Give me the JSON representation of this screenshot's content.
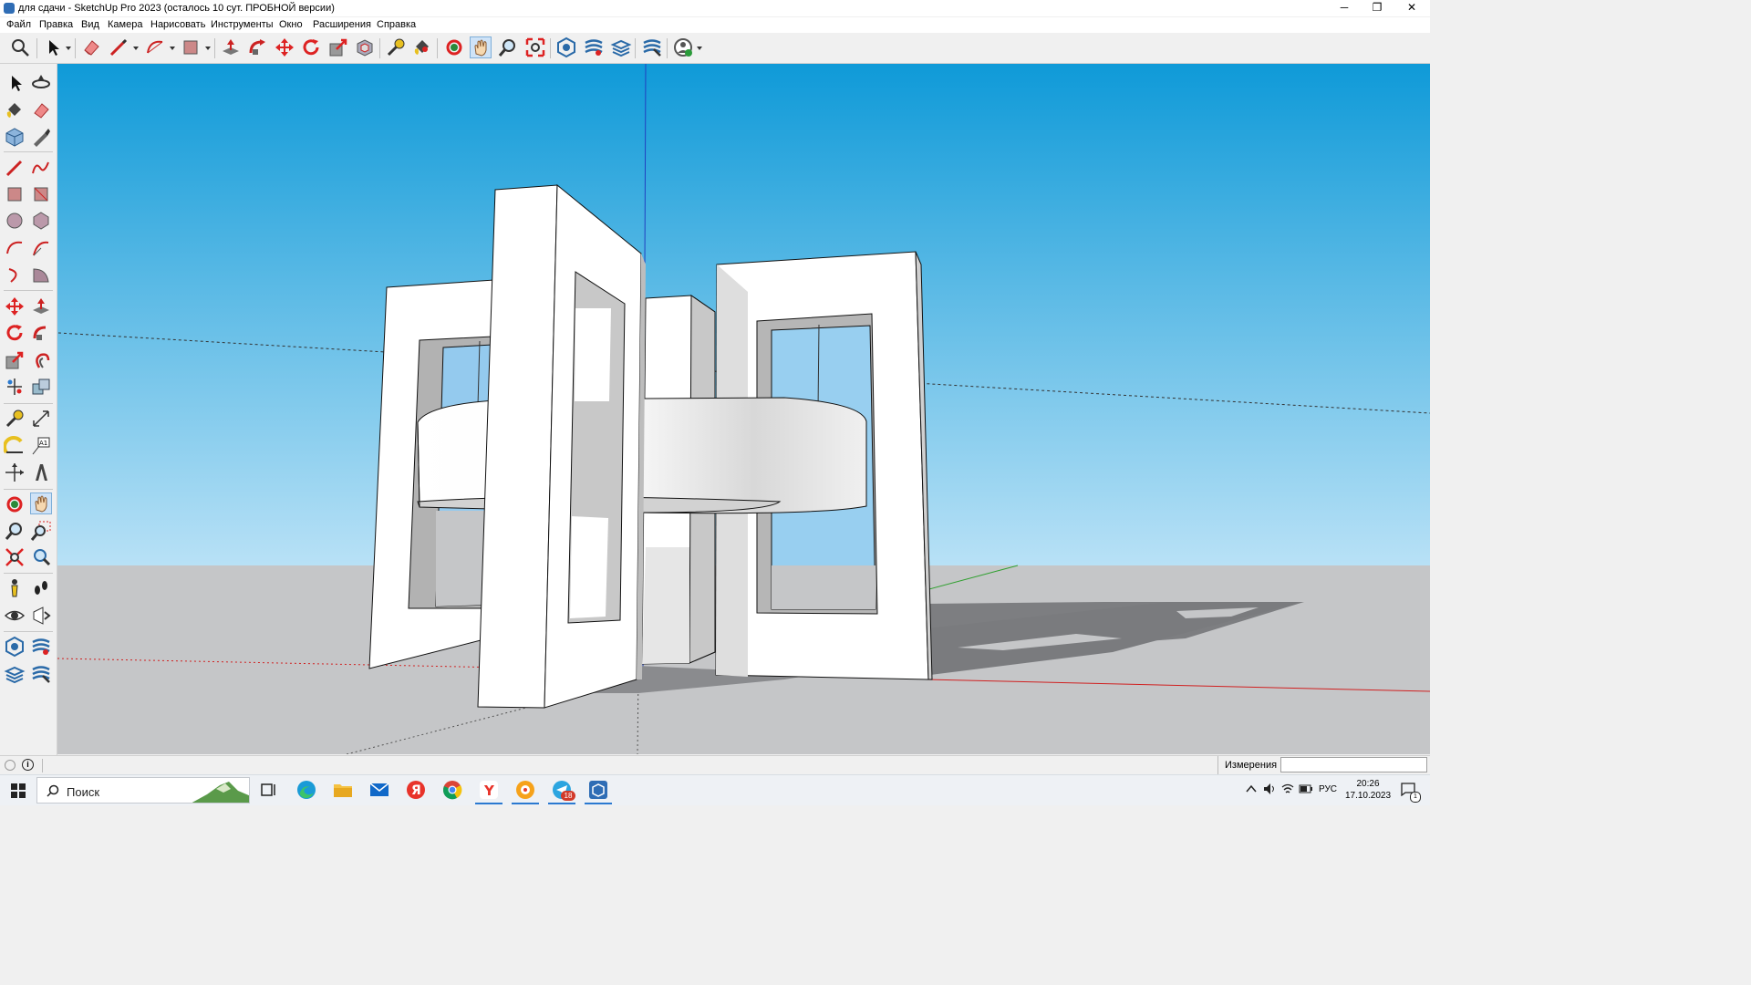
{
  "window": {
    "title": "для сдачи - SketchUp Pro 2023 (осталось 10 сут. ПРОБНОЙ версии)",
    "minimize_glyph": "─",
    "restore_glyph": "❐",
    "close_glyph": "✕"
  },
  "menu": [
    "Файл",
    "Правка",
    "Вид",
    "Камера",
    "Нарисовать",
    "Инструменты",
    "Окно",
    "Расширения",
    "Справка"
  ],
  "toolbar": {
    "icons": [
      "search-icon",
      "select-icon",
      "eraser-icon",
      "line-icon",
      "arc-icon",
      "rectangle-icon",
      "push-pull-icon",
      "follow-me-icon",
      "move-icon",
      "rotate-icon",
      "scale-icon",
      "offset-icon",
      "tape-measure-icon",
      "paint-bucket-icon",
      "orbit-icon",
      "pan-icon",
      "zoom-icon",
      "zoom-extents-icon",
      "warehouse-icon",
      "extension-warehouse-icon",
      "layout-icon",
      "extension-manager-icon",
      "profile-icon"
    ],
    "active_tool": "pan-icon"
  },
  "left_toolbar": {
    "active_tool": "pan-icon"
  },
  "status": {
    "measurements_label": "Измерения",
    "measurements_value": ""
  },
  "taskbar": {
    "search_placeholder": "Поиск",
    "time": "20:26",
    "date": "17.10.2023",
    "language": "РУС",
    "telegram_badge": "18",
    "notification_badge": "1"
  },
  "colors": {
    "sky_top": "#0f9ad8",
    "sky_bottom": "#b8e1f6",
    "ground": "#c5c6c8",
    "axis_red": "#d02020",
    "axis_green": "#30a030",
    "axis_blue": "#2040c0",
    "active_tool_bg": "#cfe3f7"
  }
}
